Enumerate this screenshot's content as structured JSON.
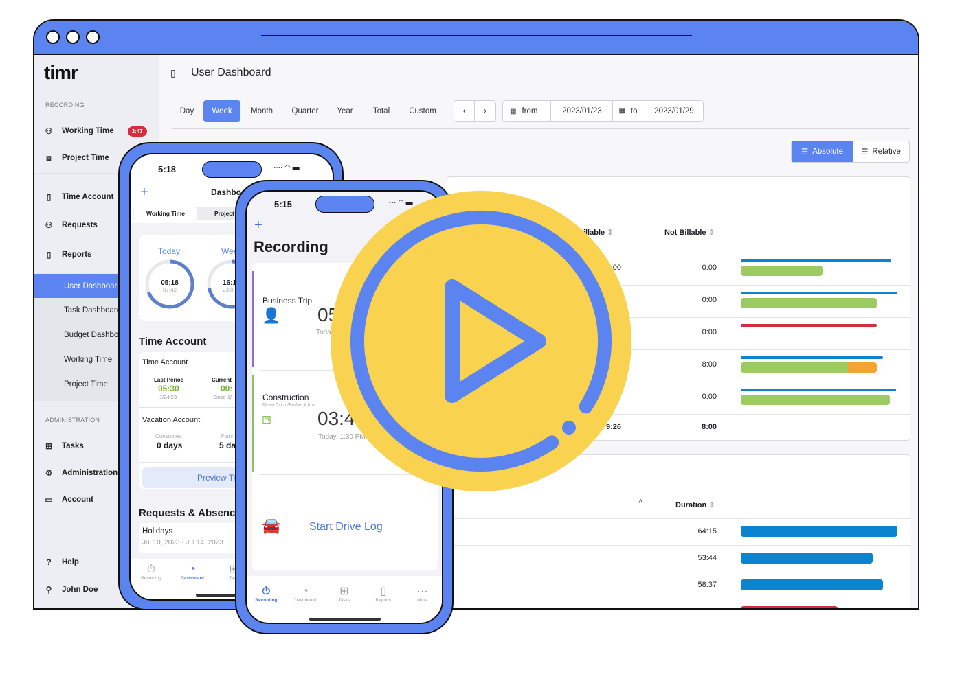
{
  "window": {
    "accent": "#5b84f0"
  },
  "sidebar": {
    "logo": "timr",
    "recording_label": "RECORDING",
    "working_time": "Working Time",
    "working_time_badge": "3:47",
    "project_time": "Project Time",
    "items": [
      {
        "label": "Time Account",
        "icon": "document-icon"
      },
      {
        "label": "Requests",
        "icon": "user-check-icon"
      },
      {
        "label": "Reports",
        "icon": "report-icon"
      }
    ],
    "sub_items": [
      "User Dashboard",
      "Task Dashboard",
      "Budget Dashboard",
      "Working Time",
      "Project Time"
    ],
    "admin_label": "ADMINISTRATION",
    "admin_items": [
      "Tasks",
      "Administration",
      "Account"
    ],
    "help": "Help",
    "user": "John Doe"
  },
  "header": {
    "title": "User Dashboard"
  },
  "periods": [
    "Day",
    "Week",
    "Month",
    "Quarter",
    "Year",
    "Total",
    "Custom"
  ],
  "active_period": "Week",
  "range": {
    "from_label": "from",
    "from": "2023/01/23",
    "to_label": "to",
    "to": "2023/01/29"
  },
  "view_toggle": {
    "absolute": "Absolute",
    "relative": "Relative",
    "active": "Absolute"
  },
  "table1": {
    "headers": {
      "billable": "Billable",
      "not_billable": "Not Billable"
    },
    "rows": [
      {
        "billable": "00",
        "not_billable": "0:00",
        "bars": [
          {
            "color": "#0b84d0",
            "value": 0.96
          },
          {
            "color": "#9ccb62",
            "value": 0.52
          }
        ]
      },
      {
        "billable": "",
        "not_billable": "0:00",
        "bars": [
          {
            "color": "#0b84d0",
            "value": 1.0
          },
          {
            "color": "#9ccb62",
            "value": 0.87
          }
        ]
      },
      {
        "billable": "",
        "not_billable": "0:00",
        "bars": [
          {
            "color": "#d12f3e",
            "value": 0.87
          }
        ]
      },
      {
        "billable": "",
        "not_billable": "8:00",
        "bars": [
          {
            "color": "#0b84d0",
            "value": 0.91
          },
          {
            "color": "#9ccb62",
            "value": 0.7,
            "extra": {
              "color": "#f3a531",
              "value": 0.17
            }
          }
        ]
      },
      {
        "billable": "",
        "not_billable": "0:00",
        "bars": [
          {
            "color": "#0b84d0",
            "value": 0.99
          },
          {
            "color": "#9ccb62",
            "value": 0.95
          }
        ]
      }
    ],
    "total": {
      "billable": "9:26",
      "not_billable": "8:00"
    }
  },
  "table2": {
    "headers": {
      "duration": "Duration"
    },
    "rows": [
      {
        "duration": "64:15",
        "color": "#0b84d0",
        "value": 1.0
      },
      {
        "duration": "53:44",
        "color": "#0b84d0",
        "value": 0.84
      },
      {
        "duration": "58:37",
        "color": "#0b84d0",
        "value": 0.91
      },
      {
        "duration": "40:00",
        "color": "#d12f3e",
        "value": 0.62
      }
    ]
  },
  "phone1": {
    "time": "5:18",
    "title": "Dashboard",
    "segments": [
      "Working Time",
      "Project Time"
    ],
    "today_label": "Today",
    "today_value": "05:18",
    "today_target": "07:42",
    "today_progress": 0.69,
    "week_label": "Week",
    "week_value": "16:1",
    "week_target": "23:0",
    "time_account_heading": "Time Account",
    "ta_card_title": "Time Account",
    "last_period_label": "Last Period",
    "last_period_value": "05:30",
    "last_period_date": "1/24/23",
    "current_label": "Current",
    "current_value": "00:",
    "current_since": "Since 1/",
    "vacation_title": "Vacation Account",
    "consumed_label": "Consumed",
    "consumed_value": "0 days",
    "planned_label": "Plann",
    "planned_value": "5 da",
    "preview_button": "Preview Ti",
    "requests_heading": "Requests & Absenc",
    "holiday_title": "Holidays",
    "holiday_dates": "Jul 10, 2023 - Jul 14, 2023",
    "tabs": [
      "Recording",
      "Dashboard",
      "Task"
    ],
    "active_tab": "Dashboard"
  },
  "phone2": {
    "time": "5:15",
    "title": "Recording",
    "entries": [
      {
        "title": "Business Trip",
        "subtitle": "",
        "value": "05",
        "when": "Toda",
        "color": "#8b6fd0"
      },
      {
        "title": "Construction",
        "subtitle": "Micro Corp./Brubeck Inc/",
        "value": "03:4",
        "when": "Today, 1:30 PM",
        "color": "#8cc45a"
      }
    ],
    "drive_log": "Start Drive Log",
    "tabs": [
      "Recording",
      "Dashboard",
      "Tasks",
      "Reports",
      "More"
    ],
    "active_tab": "Recording"
  },
  "play_overlay": {
    "fill": "#f9d24f",
    "stroke": "#5b84f0"
  }
}
